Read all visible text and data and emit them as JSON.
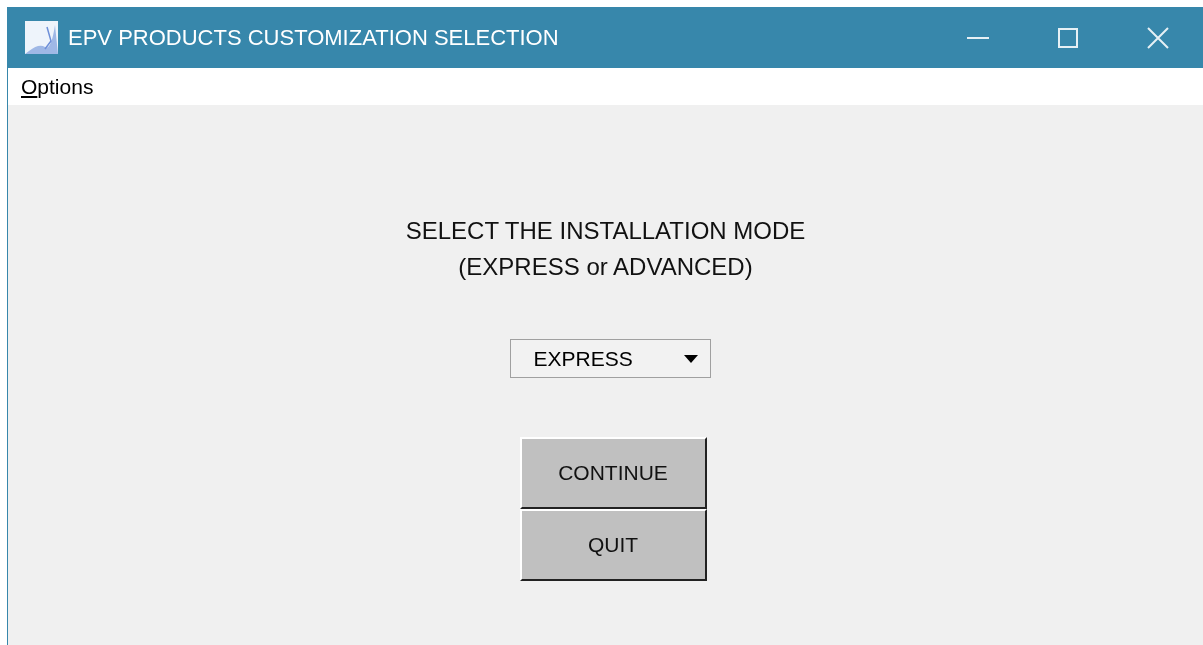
{
  "window": {
    "title": "EPV PRODUCTS CUSTOMIZATION SELECTION"
  },
  "menu": [
    {
      "label": "Options",
      "mnemonic_underlined": true
    }
  ],
  "heading": [
    "SELECT THE INSTALLATION MODE",
    "(EXPRESS or ADVANCED)"
  ],
  "mode_select": {
    "value": "EXPRESS"
  },
  "buttons": [
    {
      "label": "CONTINUE"
    },
    {
      "label": "QUIT"
    }
  ]
}
